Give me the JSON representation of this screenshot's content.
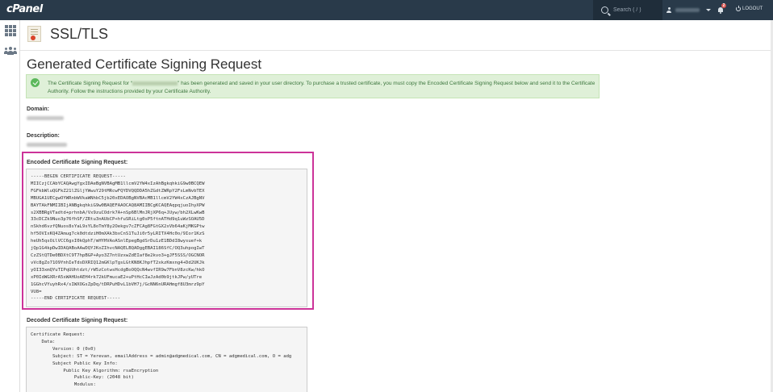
{
  "topbar": {
    "logo": "cPanel",
    "search_placeholder": "Search ( / )",
    "notification_count": "2",
    "logout_label": "LOGOUT"
  },
  "header": {
    "title": "SSL/TLS"
  },
  "main": {
    "heading": "Generated Certificate Signing Request",
    "alert_part1": "The Certificate Signing Request for “",
    "alert_part2": "” has been generated and saved in your user directory. To purchase a trusted certificate, you must copy the Encoded Certificate Signing Request below and send it to the Certificate Authority. Follow the instructions provided by your Certificate Authority.",
    "domain_label": "Domain:",
    "description_label": "Description:",
    "encoded_label": "Encoded Certificate Signing Request:",
    "encoded_csr": [
      "-----BEGIN CERTIFICATE REQUEST-----",
      "MIICzjCCAbYCAQAwgYgxIDAeBgNVBAgMB1llcmV2YW4xIzAhBgkqhkiG9w0BCQEW",
      "FGFkbWluQGFkZ21lZGljYWwuY29tMRcwFQYDVQQDDA5hZGdtZWRpY2FsLmNvbTEX",
      "MBUGA1UECgwOYWRnbWVkaWNhbC5jb20xEDAOBgNVBAcMB1llcmV2YW4xCzAJBgNV",
      "BAYTAkFNMIIBIjANBgkqhkiG9w0BAQEFAAOCAQ8AMIIBCgKCAQEAqpqjuoIhyXPW",
      "s2XBBRgVTadtd+prhnbA/Vx9zuCOdrk7A+nSp6BlMnJRjXP6q+JUyw/bh2XLwKwB",
      "33cDCZk9Nuo3p76fhSF/ZRtu3nAUbCP+hfuSRiLtg0sP5ftnATHd9q1uWzSOAU5D",
      "nSkhd6vzfQNuos8sYaL9sYL8oTmY8y2Oekgv7cZFCAg8FGtGX2xVb64aKjMKGPtw",
      "hf5OVIxKQ4ZAmug7ck0dtdziH0mXAk3bxCnS1TuJi0r5yLRITX4Hc0o/9Ior1KzS",
      "heUh5qsOilVCC6gxI0kQphT/mHYHVAoASnlEpegBgdSrDu1zE1BDdI8wysuef+k",
      "jQp1G4kpDwIDAQABoAAwDQYJKoZIhvcNAQELBQADggEBAI186SfC/OQ3uhpogIwT",
      "CzZStQTDe0BDXtC9T7hpBGP+Ayo3Z7ntUzxwZdEIaf8e2kvo3+gJF5SSS/OGCNOR",
      "vVc8gZo71O9YnhIeTdsDXRIQ12mGKlpTgsLGtKN8KJhpfT2xkzKmxng4+Dd2UKJk",
      "yOI33xmQYuTIPqUUhtdzt/rW5zCotwsHcdgBoOQQcN4wvfIR9w7FbnV8zcKw/hkO",
      "xP0IdWGXRrA5xWAHUoAEH4rk72kUFmucaE2+uPtHcCIwJzAd0b9jtkJPw/yUTre",
      "1GGhcVYuyhRx4/sIWXOGsZpDq/tDRPuHDvL1bVH7j/GcNN6nURAHmgf8U3mrz9pY",
      "VU8=",
      "-----END CERTIFICATE REQUEST-----"
    ],
    "decoded_label": "Decoded Certificate Signing Request:",
    "decoded_csr": [
      "Certificate Request:",
      "    Data:",
      "        Version: 0 (0x0)",
      "        Subject: ST = Yerevan, emailAddress = admin@adgmedical.com, CN = adgmedical.com, O = adg",
      "        Subject Public Key Info:",
      "            Public Key Algorithm: rsaEncryption",
      "                Public-Key: (2048 bit)",
      "                Modulus:"
    ]
  },
  "colors": {
    "topbar": "#293a4a",
    "highlight": "#cc3399",
    "alert_bg": "#dff0d8",
    "alert_text": "#3c763d"
  }
}
